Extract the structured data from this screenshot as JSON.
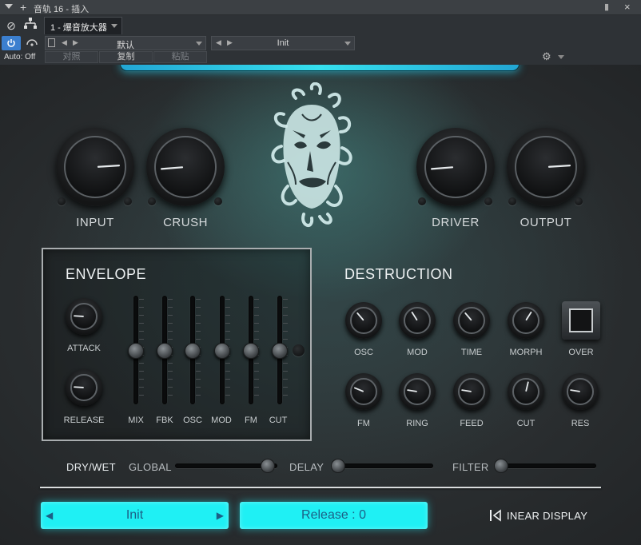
{
  "host": {
    "window_title": "音轨 16 - 插入",
    "plugin_tab": "1 - 爆音放大器",
    "auto_label": "Auto: Off",
    "preset_left": "默认",
    "preset_right": "Init",
    "actions": [
      "对照",
      "复制",
      "粘贴"
    ]
  },
  "knobs_top": [
    {
      "label": "INPUT",
      "value": 0.82
    },
    {
      "label": "CRUSH",
      "value": 0.15
    },
    {
      "label": "DRIVER",
      "value": 0.15
    },
    {
      "label": "OUTPUT",
      "value": 0.82
    }
  ],
  "envelope": {
    "title": "ENVELOPE",
    "knobs": [
      {
        "label": "ATTACK",
        "value": 0.18
      },
      {
        "label": "RELEASE",
        "value": 0.18
      }
    ],
    "sliders": [
      {
        "label": "MIX",
        "value": 0.5
      },
      {
        "label": "FBK",
        "value": 0.5
      },
      {
        "label": "OSC",
        "value": 0.5
      },
      {
        "label": "MOD",
        "value": 0.5
      },
      {
        "label": "FM",
        "value": 0.5
      },
      {
        "label": "CUT",
        "value": 0.5
      }
    ]
  },
  "destruction": {
    "title": "DESTRUCTION",
    "row1": [
      {
        "label": "OSC",
        "value": 0.35
      },
      {
        "label": "MOD",
        "value": 0.38
      },
      {
        "label": "TIME",
        "value": 0.35
      },
      {
        "label": "MORPH",
        "value": 0.62
      }
    ],
    "over_label": "OVER",
    "row2": [
      {
        "label": "FM",
        "value": 0.25
      },
      {
        "label": "RING",
        "value": 0.2
      },
      {
        "label": "FEED",
        "value": 0.2
      },
      {
        "label": "CUT",
        "value": 0.55
      },
      {
        "label": "RES",
        "value": 0.2
      }
    ]
  },
  "drywet": {
    "title": "DRY/WET",
    "global": {
      "label": "GLOBAL",
      "value": 0.97
    },
    "delay": {
      "label": "DELAY",
      "value": 0.0
    },
    "filter": {
      "label": "FILTER",
      "value": 0.0
    }
  },
  "footer": {
    "preset_name": "Init",
    "release_text": "Release : 0",
    "display_label": "INEAR DISPLAY"
  },
  "colors": {
    "accent_cyan": "#1ff0f4",
    "accent_text": "#1c5f86",
    "host_active": "#3b7fcf"
  }
}
